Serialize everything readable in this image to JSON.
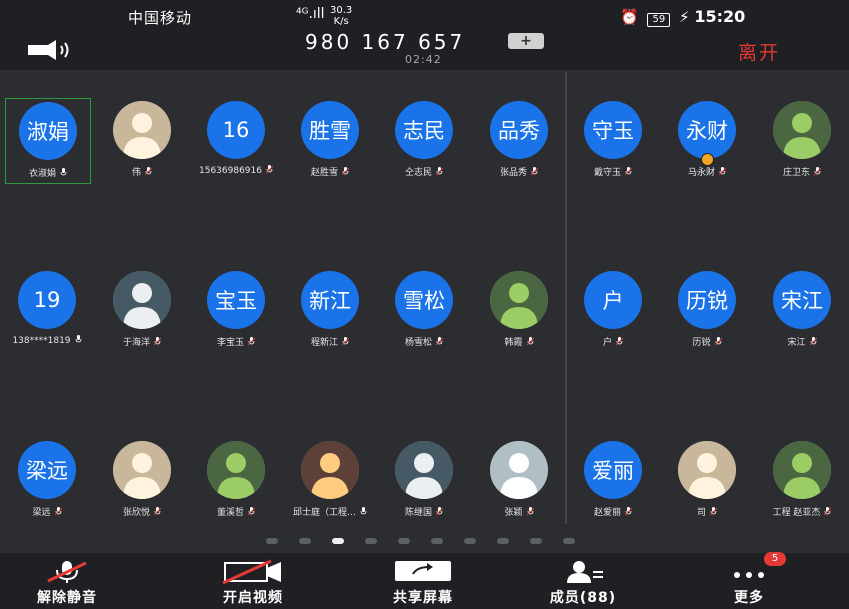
{
  "status_bar": {
    "carrier": "中国移动",
    "network": "⁴ᴳ.ıll",
    "speed_value": "30.3",
    "speed_unit": "K/s",
    "battery": "59",
    "time": "15:20"
  },
  "meeting": {
    "id": "980 167 657",
    "duration": "02:42",
    "leave_label": "离开"
  },
  "participants": [
    {
      "avatar_text": "淑娟",
      "name": "衣淑娟",
      "photo": false,
      "mic_muted": false,
      "selected": true
    },
    {
      "avatar_text": "",
      "name": "伟",
      "photo": true,
      "mic_muted": true
    },
    {
      "avatar_text": "16",
      "name": "15636986916",
      "photo": false,
      "mic_muted": true
    },
    {
      "avatar_text": "胜雪",
      "name": "赵胜雪",
      "photo": false,
      "mic_muted": true
    },
    {
      "avatar_text": "志民",
      "name": "仝志民",
      "photo": false,
      "mic_muted": true
    },
    {
      "avatar_text": "品秀",
      "name": "张品秀",
      "photo": false,
      "mic_muted": true
    },
    {
      "avatar_text": "守玉",
      "name": "戴守玉",
      "photo": false,
      "mic_muted": true
    },
    {
      "avatar_text": "永财",
      "name": "马永财",
      "photo": false,
      "mic_muted": true,
      "host": true
    },
    {
      "avatar_text": "",
      "name": "庄卫东",
      "photo": true,
      "mic_muted": true
    },
    {
      "avatar_text": "19",
      "name": "138****1819",
      "photo": false,
      "mic_muted": false
    },
    {
      "avatar_text": "",
      "name": "于海洋",
      "photo": true,
      "mic_muted": true
    },
    {
      "avatar_text": "宝玉",
      "name": "李宝玉",
      "photo": false,
      "mic_muted": true
    },
    {
      "avatar_text": "新江",
      "name": "程新江",
      "photo": false,
      "mic_muted": true
    },
    {
      "avatar_text": "雪松",
      "name": "杨雪松",
      "photo": false,
      "mic_muted": true
    },
    {
      "avatar_text": "",
      "name": "韩霞",
      "photo": true,
      "mic_muted": true
    },
    {
      "avatar_text": "户",
      "name": "户",
      "photo": false,
      "mic_muted": true
    },
    {
      "avatar_text": "历锐",
      "name": "历锐",
      "photo": false,
      "mic_muted": true
    },
    {
      "avatar_text": "宋江",
      "name": "宋江",
      "photo": false,
      "mic_muted": true
    },
    {
      "avatar_text": "梁远",
      "name": "梁远",
      "photo": false,
      "mic_muted": true
    },
    {
      "avatar_text": "",
      "name": "张欣悦",
      "photo": true,
      "mic_muted": true
    },
    {
      "avatar_text": "",
      "name": "董溪哲",
      "photo": true,
      "mic_muted": true
    },
    {
      "avatar_text": "",
      "name": "邱士庭（工程…",
      "photo": true,
      "mic_muted": false
    },
    {
      "avatar_text": "",
      "name": "陈继国",
      "photo": true,
      "mic_muted": true
    },
    {
      "avatar_text": "",
      "name": "张颖",
      "photo": true,
      "mic_muted": true
    },
    {
      "avatar_text": "爱丽",
      "name": "赵爱丽",
      "photo": false,
      "mic_muted": true
    },
    {
      "avatar_text": "",
      "name": "司",
      "photo": true,
      "mic_muted": true
    },
    {
      "avatar_text": "",
      "name": "工程 赵亚杰",
      "photo": true,
      "mic_muted": true
    }
  ],
  "pagination": {
    "pages": 10,
    "active": 2
  },
  "toolbar": {
    "unmute": "解除静音",
    "start_video": "开启视频",
    "share_screen": "共享屏幕",
    "members": "成员(88)",
    "more": "更多",
    "more_badge": "5"
  },
  "colors": {
    "accent": "#1a73e8",
    "leave": "#e53935",
    "background": "#2b2d31",
    "bar": "#1f2023",
    "selected_border": "#2e9c3e"
  }
}
